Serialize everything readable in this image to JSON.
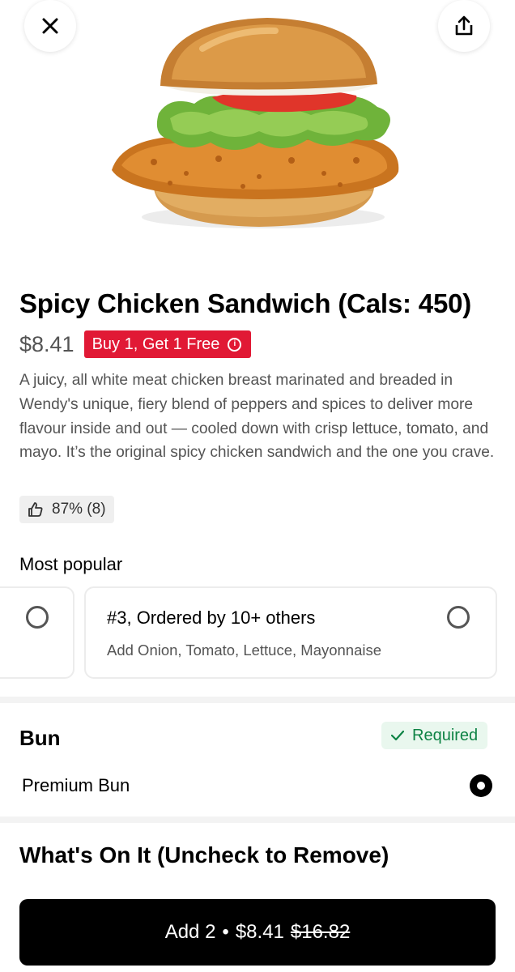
{
  "item": {
    "title": "Spicy Chicken Sandwich (Cals: 450)",
    "price": "$8.41",
    "promo_label": "Buy 1, Get 1 Free",
    "promo_info_icon": "info-icon",
    "description": "A juicy, all white meat chicken breast marinated and breaded in Wendy's unique, fiery blend of peppers and spices to deliver more flavour inside and out — cooled down with crisp lettuce, tomato, and mayo. It’s the original spicy chicken sandwich and the one you crave.",
    "rating": "87% (8)",
    "rating_icon": "thumbs-up-icon"
  },
  "header": {
    "close_icon": "close-icon",
    "share_icon": "share-icon"
  },
  "most_popular": {
    "label": "Most popular",
    "cards": [
      {
        "title": "#3, Ordered by 10+ others",
        "subtitle": "Add Onion, Tomato, Lettuce, Mayonnaise",
        "selected": false
      }
    ]
  },
  "bun": {
    "title": "Bun",
    "required_label": "Required",
    "required_icon": "check-icon",
    "options": [
      {
        "label": "Premium Bun",
        "selected": true
      }
    ]
  },
  "whats_on_it": {
    "title": "What's On It (Uncheck to Remove)"
  },
  "add_button": {
    "label": "Add 2",
    "separator": "•",
    "price": "$8.41",
    "original_price": "$16.82"
  },
  "colors": {
    "promo": "#e11935",
    "required_bg": "#e9f7ee",
    "required_text": "#0e8345",
    "button_bg": "#000000"
  }
}
